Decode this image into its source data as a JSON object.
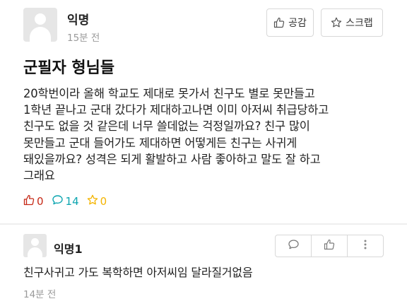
{
  "post": {
    "author": "익명",
    "time": "15분 전",
    "like_label": "공감",
    "scrap_label": "스크랩",
    "title": "군필자 형님들",
    "body": "20학번이라 올해 학교도 제대로 못가서 친구도 별로 못만들고\n1학년 끝나고 군대 갔다가 제대하고나면 이미 아저씨 취급당하고\n친구도 없을 것 같은데 너무 쓸데없는 걱정일까요? 친구 많이\n못만들고 군대 들어가도 제대하면 어떻게든 친구는 사귀게\n돼있을까요? 성격은 되게 활발하고 사람 좋아하고 말도 잘 하고\n그래요",
    "stats": {
      "likes": "0",
      "comments": "14",
      "scraps": "0"
    }
  },
  "comment": {
    "author": "익명1",
    "text": "친구사귀고 가도 복학하면 아저씨임 달라질거없음",
    "time": "14분 전"
  },
  "colors": {
    "like": "#c62917",
    "comment": "#0ca5b0",
    "scrap": "#f4b400",
    "meta": "#9a9a9a"
  }
}
